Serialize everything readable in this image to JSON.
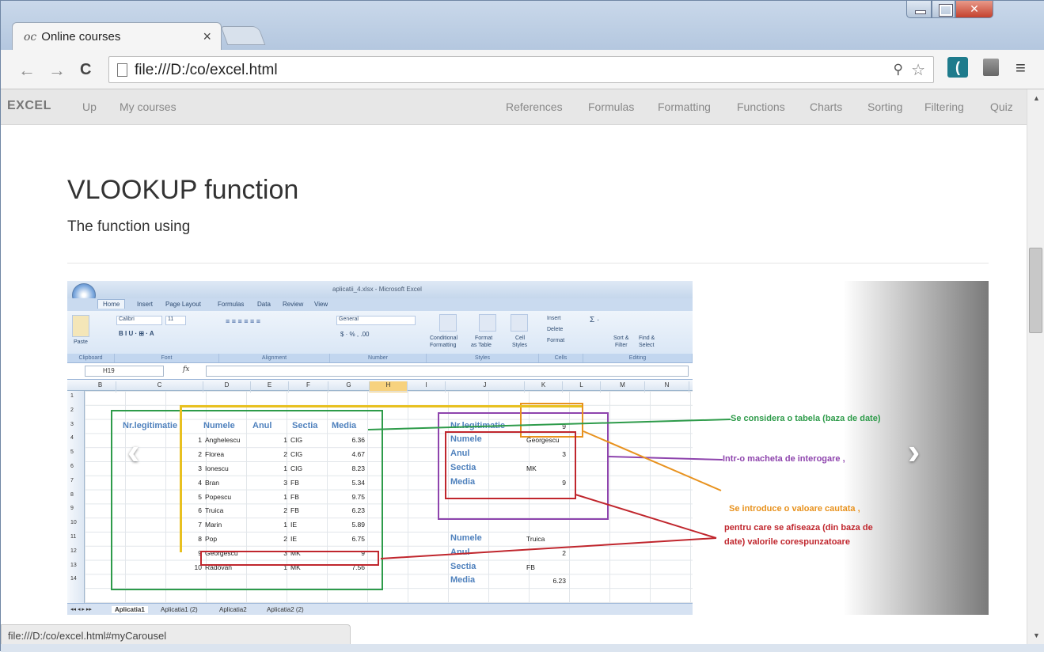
{
  "browser": {
    "tab_title": "Online courses",
    "tab_favicon": "oc",
    "tab_close": "×",
    "url": "file:///D:/co/excel.html",
    "status_url": "file:///D:/co/excel.html#myCarousel",
    "nav": {
      "back": "←",
      "forward": "→",
      "reload": "C"
    },
    "icons": [
      "zoom-icon",
      "star-icon",
      "extension-icon",
      "extension-icon",
      "menu-icon"
    ]
  },
  "navbar": {
    "brand": "EXCEL",
    "left_links": [
      "Up",
      "My courses"
    ],
    "right_links": [
      "References",
      "Formulas",
      "Formatting",
      "Functions",
      "Charts",
      "Sorting",
      "Filtering",
      "Quiz"
    ]
  },
  "page": {
    "title": "VLOOKUP function",
    "subtitle": "The function using"
  },
  "carousel": {
    "prev_label": "‹",
    "next_label": "›"
  },
  "excel": {
    "window_title": "aplicatii_4.xlsx - Microsoft Excel",
    "ribbon_tabs": [
      "Home",
      "Insert",
      "Page Layout",
      "Formulas",
      "Data",
      "Review",
      "View"
    ],
    "ribbon": {
      "paste": "Paste",
      "font_name": "Calibri",
      "font_size": "11",
      "number_format": "General",
      "conditional": "Conditional",
      "formatting": "Formatting",
      "format_table": "Format",
      "as_table": "as Table",
      "cell_styles": "Cell",
      "styles_word": "Styles",
      "insert": "Insert",
      "delete": "Delete",
      "format": "Format",
      "sort_filter": "Sort &",
      "filter": "Filter",
      "find_select": "Find &",
      "select": "Select",
      "groups": [
        "Clipboard",
        "Font",
        "Alignment",
        "Number",
        "Styles",
        "Cells",
        "Editing"
      ]
    },
    "name_box": "H19",
    "fx": "fx",
    "columns": [
      "B",
      "C",
      "D",
      "E",
      "F",
      "G",
      "H",
      "I",
      "J",
      "K",
      "L",
      "M",
      "N"
    ],
    "rows": [
      "1",
      "2",
      "3",
      "4",
      "5",
      "6",
      "7",
      "8",
      "9",
      "10",
      "11",
      "12",
      "13",
      "14"
    ],
    "table_headers": [
      "Nr.legitimatie",
      "Numele",
      "Anul",
      "Sectia",
      "Media"
    ],
    "table_rows": [
      [
        "1",
        "Anghelescu",
        "1",
        "CIG",
        "6.36"
      ],
      [
        "2",
        "Florea",
        "2",
        "CIG",
        "4.67"
      ],
      [
        "3",
        "Ionescu",
        "1",
        "CIG",
        "8.23"
      ],
      [
        "4",
        "Bran",
        "3",
        "FB",
        "5.34"
      ],
      [
        "5",
        "Popescu",
        "1",
        "FB",
        "9.75"
      ],
      [
        "6",
        "Truica",
        "2",
        "FB",
        "6.23"
      ],
      [
        "7",
        "Marin",
        "1",
        "IE",
        "5.89"
      ],
      [
        "8",
        "Pop",
        "2",
        "IE",
        "6.75"
      ],
      [
        "9",
        "Georgescu",
        "3",
        "MK",
        "9"
      ],
      [
        "10",
        "Radovan",
        "1",
        "MK",
        "7.56"
      ]
    ],
    "query1": {
      "header_label": "Nr.legitimatie",
      "header_value": "9",
      "rows": [
        [
          "Numele",
          "Georgescu"
        ],
        [
          "Anul",
          "3"
        ],
        [
          "Sectia",
          "MK"
        ],
        [
          "Media",
          "9"
        ]
      ]
    },
    "query2": {
      "rows": [
        [
          "Numele",
          "Truica"
        ],
        [
          "Anul",
          "2"
        ],
        [
          "Sectia",
          "FB"
        ],
        [
          "Media",
          "6.23"
        ]
      ]
    },
    "sheet_tabs": [
      "Aplicatia1",
      "Aplicatia1 (2)",
      "Aplicatia2",
      "Aplicatia2 (2)"
    ]
  },
  "annotations": {
    "green": "Se considera o tabela (baza de date)",
    "purple": "Intr-o macheta de  interogare ,",
    "orange": "Se introduce o valoare cautata ,",
    "red_line1": "pentru care se afiseaza (din baza de",
    "red_line2": "date) valorile corespunzatoare",
    "colors": {
      "green": "#2e9b4a",
      "purple": "#8e44ad",
      "orange": "#e8921e",
      "red": "#c0262d"
    }
  }
}
